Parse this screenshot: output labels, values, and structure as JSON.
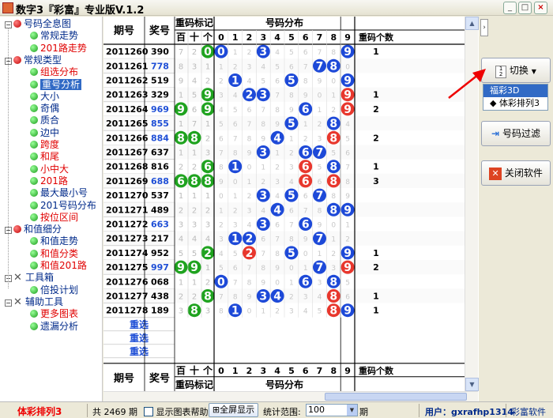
{
  "window": {
    "title": "数字3『彩富』专业版V.1.2",
    "buttons": [
      "_",
      "□",
      "×"
    ]
  },
  "tree": [
    {
      "label": "号码全息图",
      "type": "group",
      "indent": 0
    },
    {
      "label": "常规走势",
      "type": "item",
      "color": "blue",
      "indent": 1
    },
    {
      "label": "201路走势",
      "type": "item",
      "color": "red",
      "indent": 1
    },
    {
      "label": "常规类型",
      "type": "group",
      "indent": 0
    },
    {
      "label": "组选分布",
      "type": "item",
      "color": "red",
      "indent": 1
    },
    {
      "label": "重号分析",
      "type": "item",
      "color": "blue",
      "indent": 1,
      "selected": true
    },
    {
      "label": "大小",
      "type": "item",
      "color": "blue",
      "indent": 1
    },
    {
      "label": "奇偶",
      "type": "item",
      "color": "blue",
      "indent": 1
    },
    {
      "label": "质合",
      "type": "item",
      "color": "blue",
      "indent": 1
    },
    {
      "label": "边中",
      "type": "item",
      "color": "blue",
      "indent": 1
    },
    {
      "label": "跨度",
      "type": "item",
      "color": "red",
      "indent": 1
    },
    {
      "label": "和尾",
      "type": "item",
      "color": "red",
      "indent": 1
    },
    {
      "label": "小中大",
      "type": "item",
      "color": "red",
      "indent": 1
    },
    {
      "label": "201路",
      "type": "item",
      "color": "red",
      "indent": 1
    },
    {
      "label": "最大最小号",
      "type": "item",
      "color": "blue",
      "indent": 1
    },
    {
      "label": "201号码分布",
      "type": "item",
      "color": "blue",
      "indent": 1
    },
    {
      "label": "按位区间",
      "type": "item",
      "color": "red",
      "indent": 1
    },
    {
      "label": "和值细分",
      "type": "group",
      "indent": 0
    },
    {
      "label": "和值走势",
      "type": "item",
      "color": "blue",
      "indent": 1
    },
    {
      "label": "和值分类",
      "type": "item",
      "color": "red",
      "indent": 1
    },
    {
      "label": "和值201路",
      "type": "item",
      "color": "red",
      "indent": 1
    },
    {
      "label": "工具箱",
      "type": "tool",
      "indent": 0
    },
    {
      "label": "倍投计划",
      "type": "item",
      "color": "blue",
      "indent": 1
    },
    {
      "label": "辅助工具",
      "type": "tool",
      "indent": 0
    },
    {
      "label": "更多图表",
      "type": "item",
      "color": "red",
      "indent": 1
    },
    {
      "label": "遗漏分析",
      "type": "item",
      "color": "blue",
      "indent": 1
    }
  ],
  "grid": {
    "header": {
      "issue": "期号",
      "prize": "奖号",
      "repeat_group": "重码标记",
      "repeat_cols": [
        "百",
        "十",
        "个"
      ],
      "dist_group": "号码分布",
      "digits": [
        "0",
        "1",
        "2",
        "3",
        "4",
        "5",
        "6",
        "7",
        "8",
        "9"
      ],
      "count": "重码个数"
    },
    "rows": [
      {
        "issue": "2011260",
        "prize": "390",
        "pblue": false,
        "rep": [
          "7",
          "2",
          "0"
        ],
        "cnt": "1"
      },
      {
        "issue": "2011261",
        "prize": "778",
        "pblue": true,
        "rep": [
          "8",
          "3",
          "1"
        ],
        "cnt": ""
      },
      {
        "issue": "2011262",
        "prize": "519",
        "pblue": false,
        "rep": [
          "9",
          "4",
          "2"
        ],
        "cnt": ""
      },
      {
        "issue": "2011263",
        "prize": "329",
        "pblue": false,
        "rep": [
          "1",
          "5",
          "9"
        ],
        "cnt": "1"
      },
      {
        "issue": "2011264",
        "prize": "969",
        "pblue": true,
        "rep": [
          "9",
          "6",
          "9"
        ],
        "cnt": "2"
      },
      {
        "issue": "2011265",
        "prize": "855",
        "pblue": true,
        "rep": [
          "1",
          "7",
          "1"
        ],
        "cnt": ""
      },
      {
        "issue": "2011266",
        "prize": "884",
        "pblue": true,
        "rep": [
          "8",
          "8",
          "2"
        ],
        "cnt": "2"
      },
      {
        "issue": "2011267",
        "prize": "637",
        "pblue": false,
        "rep": [
          "1",
          "1",
          "3"
        ],
        "cnt": ""
      },
      {
        "issue": "2011268",
        "prize": "816",
        "pblue": false,
        "rep": [
          "2",
          "2",
          "6"
        ],
        "cnt": "1"
      },
      {
        "issue": "2011269",
        "prize": "688",
        "pblue": true,
        "rep": [
          "6",
          "8",
          "8"
        ],
        "cnt": "3"
      },
      {
        "issue": "2011270",
        "prize": "537",
        "pblue": false,
        "rep": [
          "1",
          "1",
          "1"
        ],
        "cnt": ""
      },
      {
        "issue": "2011271",
        "prize": "489",
        "pblue": false,
        "rep": [
          "2",
          "2",
          "2"
        ],
        "cnt": ""
      },
      {
        "issue": "2011272",
        "prize": "663",
        "pblue": true,
        "rep": [
          "3",
          "3",
          "3"
        ],
        "cnt": ""
      },
      {
        "issue": "2011273",
        "prize": "217",
        "pblue": false,
        "rep": [
          "4",
          "4",
          "4"
        ],
        "cnt": ""
      },
      {
        "issue": "2011274",
        "prize": "952",
        "pblue": false,
        "rep": [
          "5",
          "5",
          "2"
        ],
        "cnt": "1"
      },
      {
        "issue": "2011275",
        "prize": "997",
        "pblue": true,
        "rep": [
          "9",
          "9",
          "1"
        ],
        "cnt": "2"
      },
      {
        "issue": "2011276",
        "prize": "068",
        "pblue": false,
        "rep": [
          "1",
          "1",
          "2"
        ],
        "cnt": ""
      },
      {
        "issue": "2011277",
        "prize": "438",
        "pblue": false,
        "rep": [
          "2",
          "2",
          "8"
        ],
        "cnt": "1"
      },
      {
        "issue": "2011278",
        "prize": "189",
        "pblue": false,
        "rep": [
          "3",
          "8",
          "3"
        ],
        "cnt": "1"
      }
    ],
    "repeat_hits": [
      [
        false,
        false,
        true
      ],
      [
        false,
        false,
        false
      ],
      [
        false,
        false,
        false
      ],
      [
        false,
        false,
        true
      ],
      [
        true,
        false,
        true
      ],
      [
        false,
        false,
        false
      ],
      [
        true,
        true,
        false
      ],
      [
        false,
        false,
        false
      ],
      [
        false,
        false,
        true
      ],
      [
        true,
        true,
        true
      ],
      [
        false,
        false,
        false
      ],
      [
        false,
        false,
        false
      ],
      [
        false,
        false,
        false
      ],
      [
        false,
        false,
        false
      ],
      [
        false,
        false,
        true
      ],
      [
        true,
        true,
        false
      ],
      [
        false,
        false,
        false
      ],
      [
        false,
        false,
        true
      ],
      [
        false,
        true,
        false
      ]
    ],
    "reselect": [
      "重选",
      "重选",
      "重选"
    ]
  },
  "sidebar": {
    "switch_label": "切换",
    "menu": [
      "福彩3D",
      "体彩排列3"
    ],
    "filter_label": "号码过滤",
    "close_label": "关闭软件"
  },
  "status": {
    "game": "体彩排列3",
    "total": "共 2469 期",
    "show_help": "显示图表帮助",
    "fullscreen": "全屏显示",
    "range_label": "统计范围:",
    "range_value": "100",
    "range_unit": "期",
    "user": "用户：gxrafhp1314",
    "brand": "彩富软件"
  }
}
